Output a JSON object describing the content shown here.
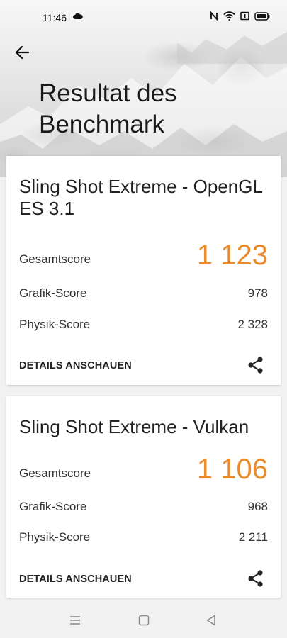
{
  "status": {
    "time": "11:46"
  },
  "header": {
    "title": "Resultat des Benchmark"
  },
  "cards": [
    {
      "title": "Sling Shot Extreme - OpenGL ES 3.1",
      "total_label": "Gesamtscore",
      "total_value": "1 123",
      "graphics_label": "Grafik-Score",
      "graphics_value": "978",
      "physics_label": "Physik-Score",
      "physics_value": "2 328",
      "details_label": "DETAILS ANSCHAUEN"
    },
    {
      "title": "Sling Shot Extreme - Vulkan",
      "total_label": "Gesamtscore",
      "total_value": "1 106",
      "graphics_label": "Grafik-Score",
      "graphics_value": "968",
      "physics_label": "Physik-Score",
      "physics_value": "2 211",
      "details_label": "DETAILS ANSCHAUEN"
    }
  ],
  "icons": {
    "back": "arrow-left-icon",
    "share": "share-icon",
    "nav_menu": "menu-icon",
    "nav_home": "square-icon",
    "nav_back": "triangle-back-icon"
  },
  "colors": {
    "accent": "#e98a2c"
  }
}
